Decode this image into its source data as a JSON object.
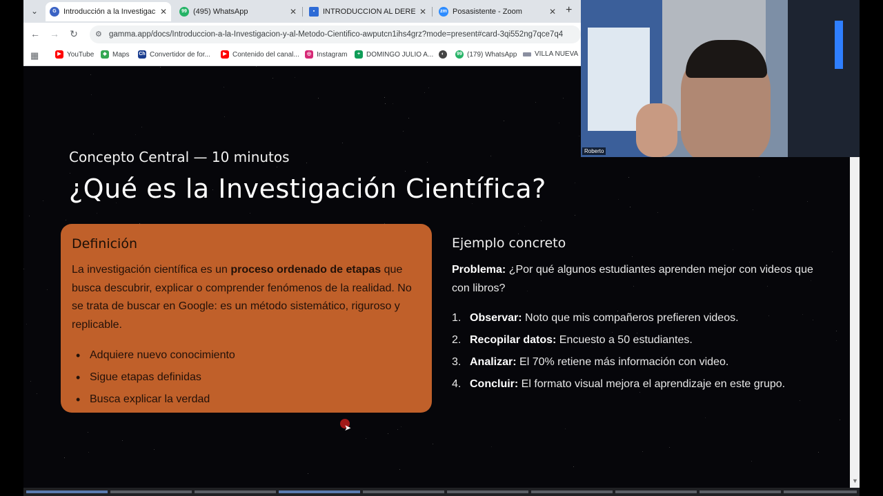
{
  "browser": {
    "tabs": [
      {
        "title": "Introducción a la Investigación",
        "icon": "gamma-icon",
        "active": true
      },
      {
        "title": "(495) WhatsApp",
        "icon": "whatsapp-icon",
        "active": false
      },
      {
        "title": "INTRODUCCION AL DERECHO",
        "icon": "classroom-icon",
        "active": false
      },
      {
        "title": "Posasistente - Zoom",
        "icon": "zoom-icon",
        "active": false
      }
    ],
    "url": "gamma.app/docs/Introduccion-a-la-Investigacion-y-al-Metodo-Cientifico-awputcn1ihs4grz?mode=present#card-3qi552ng7qce7q4",
    "bookmarks": [
      "YouTube",
      "Maps",
      "Convertidor de for...",
      "Contenido del canal...",
      "Instagram",
      "DOMINGO JULIO A...",
      "",
      "(179) WhatsApp",
      "VILLA NUEVA"
    ]
  },
  "slide": {
    "kicker": "Concepto Central — 10 minutos",
    "title": "¿Qué es la Investigación Científica?",
    "definition": {
      "heading": "Definición",
      "text_before": "La investigación científica es un ",
      "text_bold": "proceso ordenado de etapas",
      "text_after": " que busca descubrir, explicar o comprender fenómenos de la realidad. No se trata de buscar en Google: es un método sistemático, riguroso y replicable.",
      "bullets": [
        "Adquiere nuevo conocimiento",
        "Sigue etapas definidas",
        "Busca explicar la verdad"
      ]
    },
    "example": {
      "heading": "Ejemplo concreto",
      "problem_label": "Problema:",
      "problem_text": " ¿Por qué algunos estudiantes aprenden mejor con videos que con libros?",
      "steps": [
        {
          "num": "1.",
          "label": "Observar:",
          "text": " Noto que mis compañeros prefieren videos."
        },
        {
          "num": "2.",
          "label": "Recopilar datos:",
          "text": " Encuesto a 50 estudiantes."
        },
        {
          "num": "3.",
          "label": "Analizar:",
          "text": " El 70% retiene más información con video."
        },
        {
          "num": "4.",
          "label": "Concluir:",
          "text": " El formato visual mejora el aprendizaje en este grupo."
        }
      ]
    }
  },
  "webcam": {
    "participant_name": "Roberto"
  },
  "colors": {
    "card": "#c0602a",
    "slide_bg": "#06060a"
  }
}
